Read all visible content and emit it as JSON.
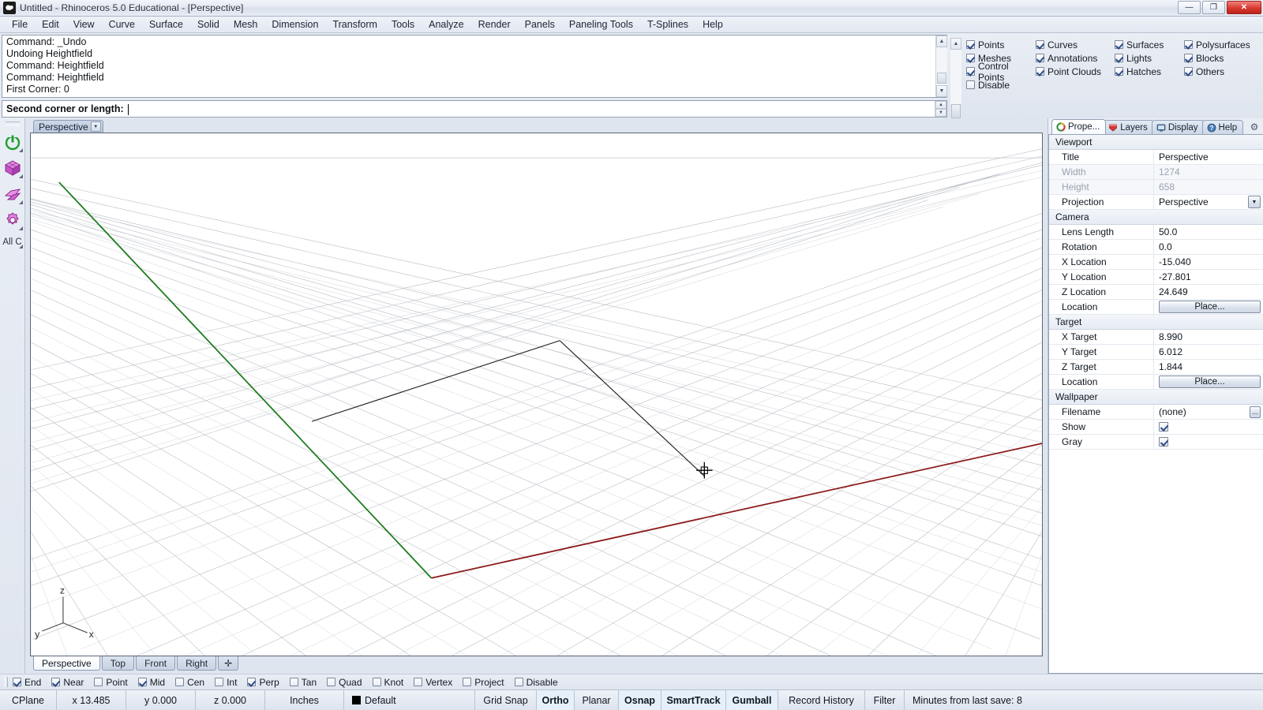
{
  "window": {
    "title": "Untitled - Rhinoceros 5.0 Educational - [Perspective]",
    "icon": "rhino-head-icon",
    "minimize": "—",
    "maximize": "❐",
    "close": "✕"
  },
  "menu": {
    "items": [
      "File",
      "Edit",
      "View",
      "Curve",
      "Surface",
      "Solid",
      "Mesh",
      "Dimension",
      "Transform",
      "Tools",
      "Analyze",
      "Render",
      "Panels",
      "Paneling Tools",
      "T-Splines",
      "Help"
    ]
  },
  "command": {
    "history": [
      "Command: _Undo",
      "Undoing Heightfield",
      "Command: Heightfield",
      "Command: Heightfield",
      "First Corner: 0"
    ],
    "prompt_label": "Second corner or length:",
    "prompt_value": "",
    "scroll_up": "▲",
    "scroll_down": "▼"
  },
  "object_filter": {
    "items": [
      {
        "label": "Points",
        "checked": true
      },
      {
        "label": "Curves",
        "checked": true
      },
      {
        "label": "Surfaces",
        "checked": true
      },
      {
        "label": "Polysurfaces",
        "checked": true
      },
      {
        "label": "Meshes",
        "checked": true
      },
      {
        "label": "Annotations",
        "checked": true
      },
      {
        "label": "Lights",
        "checked": true
      },
      {
        "label": "Blocks",
        "checked": true
      },
      {
        "label": "Control Points",
        "checked": true
      },
      {
        "label": "Point Clouds",
        "checked": true
      },
      {
        "label": "Hatches",
        "checked": true
      },
      {
        "label": "Others",
        "checked": true
      },
      {
        "label": "Disable",
        "checked": false
      }
    ]
  },
  "left_toolbar": {
    "items": [
      {
        "name": "power-standard-icon",
        "label": ""
      },
      {
        "name": "box-solid-icon",
        "label": ""
      },
      {
        "name": "surface-icon",
        "label": ""
      },
      {
        "name": "gear-mesh-icon",
        "label": ""
      }
    ],
    "all_label": "All C"
  },
  "viewport": {
    "title": "Perspective",
    "dropdown_arrow": "▼",
    "axis_labels": {
      "x": "x",
      "y": "y",
      "z": "z"
    },
    "tabs": [
      {
        "label": "Perspective",
        "active": true
      },
      {
        "label": "Top",
        "active": false
      },
      {
        "label": "Front",
        "active": false
      },
      {
        "label": "Right",
        "active": false
      },
      {
        "label": "✛",
        "active": false
      }
    ]
  },
  "panel": {
    "tabs": [
      {
        "label": "Prope...",
        "icon": "properties-icon",
        "active": true
      },
      {
        "label": "Layers",
        "icon": "layers-icon",
        "active": false
      },
      {
        "label": "Display",
        "icon": "display-icon",
        "active": false
      },
      {
        "label": "Help",
        "icon": "help-icon",
        "active": false
      }
    ],
    "gear": "⚙",
    "groups": [
      {
        "title": "Viewport",
        "rows": [
          {
            "label": "Title",
            "value": "Perspective",
            "type": "text",
            "dim": false
          },
          {
            "label": "Width",
            "value": "1274",
            "type": "text",
            "dim": true
          },
          {
            "label": "Height",
            "value": "658",
            "type": "text",
            "dim": true
          },
          {
            "label": "Projection",
            "value": "Perspective",
            "type": "dropdown",
            "dim": false
          }
        ]
      },
      {
        "title": "Camera",
        "rows": [
          {
            "label": "Lens Length",
            "value": "50.0",
            "type": "text",
            "dim": false
          },
          {
            "label": "Rotation",
            "value": "0.0",
            "type": "text",
            "dim": false
          },
          {
            "label": "X Location",
            "value": "-15.040",
            "type": "text",
            "dim": false
          },
          {
            "label": "Y Location",
            "value": "-27.801",
            "type": "text",
            "dim": false
          },
          {
            "label": "Z Location",
            "value": "24.649",
            "type": "text",
            "dim": false
          },
          {
            "label": "Location",
            "value": "Place...",
            "type": "button",
            "dim": false
          }
        ]
      },
      {
        "title": "Target",
        "rows": [
          {
            "label": "X Target",
            "value": "8.990",
            "type": "text",
            "dim": false
          },
          {
            "label": "Y Target",
            "value": "6.012",
            "type": "text",
            "dim": false
          },
          {
            "label": "Z Target",
            "value": "1.844",
            "type": "text",
            "dim": false
          },
          {
            "label": "Location",
            "value": "Place...",
            "type": "button",
            "dim": false
          }
        ]
      },
      {
        "title": "Wallpaper",
        "rows": [
          {
            "label": "Filename",
            "value": "(none)",
            "type": "file",
            "dim": false
          },
          {
            "label": "Show",
            "value": "",
            "type": "checkbox",
            "checked": true,
            "dim": false
          },
          {
            "label": "Gray",
            "value": "",
            "type": "checkbox",
            "checked": true,
            "dim": false
          }
        ]
      }
    ]
  },
  "osnap": {
    "items": [
      {
        "label": "End",
        "checked": true
      },
      {
        "label": "Near",
        "checked": true
      },
      {
        "label": "Point",
        "checked": false
      },
      {
        "label": "Mid",
        "checked": true
      },
      {
        "label": "Cen",
        "checked": false
      },
      {
        "label": "Int",
        "checked": false
      },
      {
        "label": "Perp",
        "checked": true
      },
      {
        "label": "Tan",
        "checked": false
      },
      {
        "label": "Quad",
        "checked": false
      },
      {
        "label": "Knot",
        "checked": false
      },
      {
        "label": "Vertex",
        "checked": false
      },
      {
        "label": "Project",
        "checked": false
      },
      {
        "label": "Disable",
        "checked": false
      }
    ]
  },
  "statusbar": {
    "cplane": "CPlane",
    "x": "x 13.485",
    "y": "y 0.000",
    "z": "z 0.000",
    "units": "Inches",
    "layer": "Default",
    "layer_color": "#000000",
    "toggles": [
      {
        "label": "Grid Snap",
        "active": false,
        "bold": false
      },
      {
        "label": "Ortho",
        "active": true,
        "bold": true
      },
      {
        "label": "Planar",
        "active": false,
        "bold": false
      },
      {
        "label": "Osnap",
        "active": true,
        "bold": true
      },
      {
        "label": "SmartTrack",
        "active": true,
        "bold": true
      },
      {
        "label": "Gumball",
        "active": true,
        "bold": true
      },
      {
        "label": "Record History",
        "active": false,
        "bold": false
      },
      {
        "label": "Filter",
        "active": false,
        "bold": false
      }
    ],
    "save_info": "Minutes from last save: 8"
  },
  "colors": {
    "x_axis": "#8b1a1a",
    "y_axis": "#1a7a1a",
    "grid_line": "#b9bec6",
    "curve": "#1a1a1a",
    "viewport_bg": "#ffffff"
  }
}
